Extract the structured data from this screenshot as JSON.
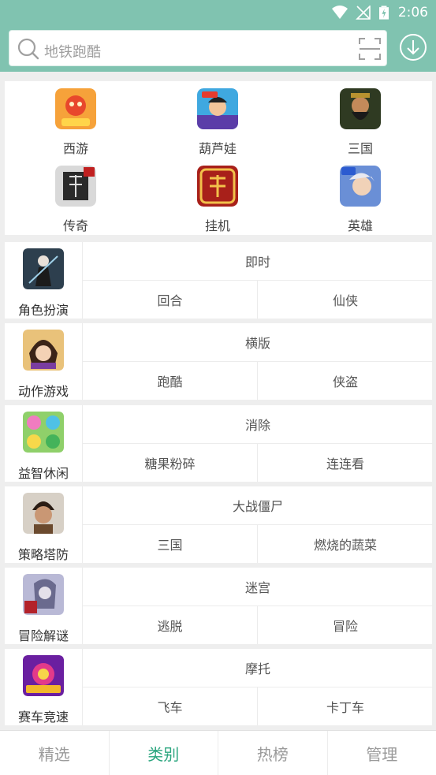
{
  "status_bar": {
    "time": "2:06"
  },
  "search": {
    "placeholder": "地铁跑酷"
  },
  "featured": [
    {
      "label": "西游",
      "icon": "xiyou-game-icon"
    },
    {
      "label": "葫芦娃",
      "icon": "huluwa-game-icon"
    },
    {
      "label": "三国",
      "icon": "sanguo-game-icon"
    },
    {
      "label": "传奇",
      "icon": "chuanqi-game-icon"
    },
    {
      "label": "挂机",
      "icon": "guaji-game-icon"
    },
    {
      "label": "英雄",
      "icon": "yingxiong-game-icon"
    }
  ],
  "categories": [
    {
      "name": "角色扮演",
      "top": "即时",
      "sub": [
        "回合",
        "仙侠"
      ]
    },
    {
      "name": "动作游戏",
      "top": "横版",
      "sub": [
        "跑酷",
        "侠盗"
      ]
    },
    {
      "name": "益智休闲",
      "top": "消除",
      "sub": [
        "糖果粉碎",
        "连连看"
      ]
    },
    {
      "name": "策略塔防",
      "top": "大战僵尸",
      "sub": [
        "三国",
        "燃烧的蔬菜"
      ]
    },
    {
      "name": "冒险解谜",
      "top": "迷宫",
      "sub": [
        "逃脱",
        "冒险"
      ]
    },
    {
      "name": "赛车竞速",
      "top": "摩托",
      "sub": [
        "飞车",
        "卡丁车"
      ]
    }
  ],
  "bottom_nav": [
    {
      "label": "精选",
      "active": false
    },
    {
      "label": "类别",
      "active": true
    },
    {
      "label": "热榜",
      "active": false
    },
    {
      "label": "管理",
      "active": false
    }
  ],
  "colors": {
    "header": "#80c3b0",
    "accent": "#2aa57e",
    "background": "#eeeeee"
  }
}
